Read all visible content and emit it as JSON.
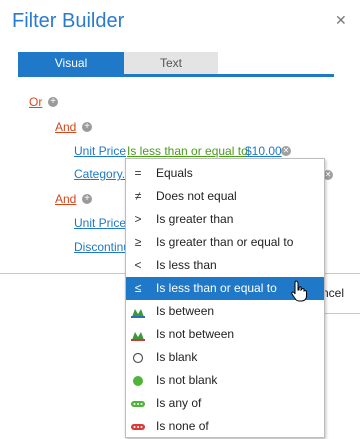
{
  "dialog": {
    "title": "Filter Builder",
    "close_glyph": "✕"
  },
  "tabs": [
    {
      "label": "Visual",
      "active": true
    },
    {
      "label": "Text",
      "active": false
    }
  ],
  "tree": {
    "root_op": "Or",
    "group1_op": "And",
    "cond1": {
      "field": "Unit Price",
      "operator": "Is less than or equal to",
      "value": "$10.00"
    },
    "cond2_field": "Category...",
    "group2_op": "And",
    "cond3_field": "Unit Price",
    "cond4_field": "Discontinu"
  },
  "button_fragment": "ncel",
  "menu": {
    "selected_index": 5,
    "items": [
      {
        "label": "Equals",
        "icon": "equals-icon",
        "glyph": "="
      },
      {
        "label": "Does not equal",
        "icon": "not-equal-icon",
        "glyph": "≠"
      },
      {
        "label": "Is greater than",
        "icon": "greater-than-icon",
        "glyph": ">"
      },
      {
        "label": "Is greater than or equal to",
        "icon": "greater-equal-icon",
        "glyph": "≥"
      },
      {
        "label": "Is less than",
        "icon": "less-than-icon",
        "glyph": "<"
      },
      {
        "label": "Is less than or equal to",
        "icon": "less-equal-icon",
        "glyph": "≤"
      },
      {
        "label": "Is between",
        "icon": "between-icon",
        "glyph": ""
      },
      {
        "label": "Is not between",
        "icon": "not-between-icon",
        "glyph": ""
      },
      {
        "label": "Is blank",
        "icon": "blank-icon",
        "glyph": ""
      },
      {
        "label": "Is not blank",
        "icon": "not-blank-icon",
        "glyph": ""
      },
      {
        "label": "Is any of",
        "icon": "any-of-icon",
        "glyph": ""
      },
      {
        "label": "Is none of",
        "icon": "none-of-icon",
        "glyph": ""
      }
    ]
  },
  "colors": {
    "accent": "#1f78c8",
    "group_red": "#d4471f",
    "operator_green": "#4a9a1a"
  }
}
